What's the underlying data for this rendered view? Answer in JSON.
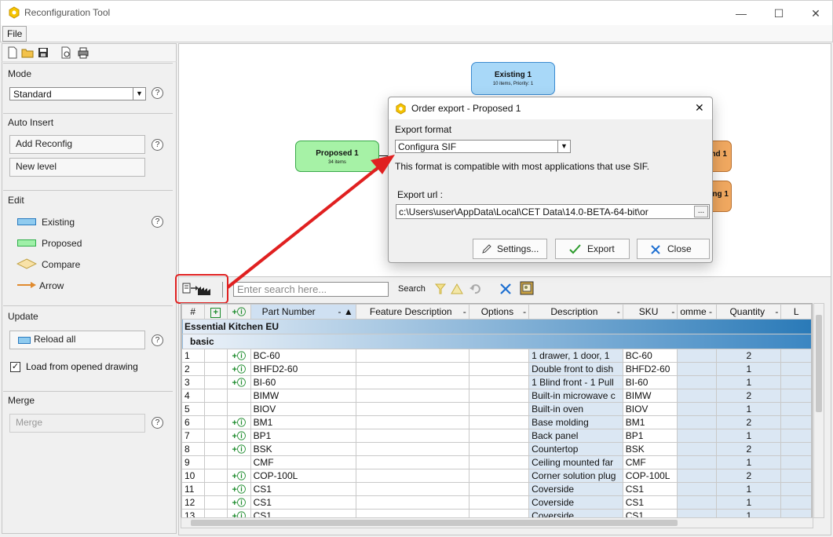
{
  "window": {
    "title": "Reconfiguration Tool",
    "controls": {
      "minimize": "—",
      "maximize": "☐",
      "close": "✕"
    }
  },
  "menu": {
    "file": "File"
  },
  "left_panel": {
    "mode": {
      "title": "Mode",
      "value": "Standard"
    },
    "auto_insert": {
      "title": "Auto Insert",
      "add_reconfig": "Add Reconfig",
      "new_level": "New level"
    },
    "edit": {
      "title": "Edit",
      "legend": [
        {
          "label": "Existing",
          "color": "#8fcbef"
        },
        {
          "label": "Proposed",
          "color": "#9ff0a8"
        },
        {
          "label": "Compare",
          "color": "#f8e2a8"
        },
        {
          "label": "Arrow",
          "color": "#e08a2e"
        }
      ]
    },
    "update": {
      "title": "Update",
      "reload_all": "Reload all",
      "load_from_opened": "Load from opened drawing",
      "load_checked": true
    },
    "merge": {
      "title": "Merge",
      "merge_button": "Merge"
    },
    "help": "?"
  },
  "canvas": {
    "nodes": {
      "existing": {
        "label": "Existing 1",
        "sub": "10 items, Priority: 1",
        "color": "#a8d8f8"
      },
      "proposed": {
        "label": "Proposed 1",
        "sub": "34 items",
        "color": "#a6f2a6"
      },
      "orange1": {
        "label": "nd 1",
        "color": "#f0a860"
      },
      "orange2": {
        "label": "ing 1",
        "color": "#f0a860"
      }
    }
  },
  "dialog": {
    "title": "Order export - Proposed 1",
    "format_label": "Export format",
    "format_value": "Configura SIF",
    "format_note": "This format is compatible with most applications that use SIF.",
    "url_label": "Export url :",
    "url_value": "c:\\Users\\user\\AppData\\Local\\CET Data\\14.0-BETA-64-bit\\or",
    "browse": "...",
    "buttons": {
      "settings": "Settings...",
      "export": "Export",
      "close": "Close"
    },
    "close_x": "✕"
  },
  "grid_toolbar": {
    "search_placeholder": "Enter search here...",
    "search_label": "Search"
  },
  "grid": {
    "columns": [
      "#",
      "+",
      "i",
      "Part Number",
      "Feature Description",
      "Options",
      "Description",
      "SKU",
      "omme",
      "Quantity",
      "L"
    ],
    "group": "Essential Kitchen EU",
    "subgroup": "basic",
    "rows": [
      {
        "n": "1",
        "icon": true,
        "part": "BC-60",
        "desc": "1 drawer, 1 door, 1",
        "sku": "BC-60",
        "qty": "2"
      },
      {
        "n": "2",
        "icon": true,
        "part": "BHFD2-60",
        "desc": "Double front to dish",
        "sku": "BHFD2-60",
        "qty": "1"
      },
      {
        "n": "3",
        "icon": true,
        "part": "BI-60",
        "desc": "1 Blind front - 1 Pull",
        "sku": "BI-60",
        "qty": "1"
      },
      {
        "n": "4",
        "icon": false,
        "part": "BIMW",
        "desc": "Built-in microwave c",
        "sku": "BIMW",
        "qty": "2"
      },
      {
        "n": "5",
        "icon": false,
        "part": "BIOV",
        "desc": "Built-in oven",
        "sku": "BIOV",
        "qty": "1"
      },
      {
        "n": "6",
        "icon": true,
        "part": "BM1",
        "desc": "Base molding",
        "sku": "BM1",
        "qty": "2"
      },
      {
        "n": "7",
        "icon": true,
        "part": "BP1",
        "desc": "Back panel",
        "sku": "BP1",
        "qty": "1"
      },
      {
        "n": "8",
        "icon": true,
        "part": "BSK",
        "desc": "Countertop",
        "sku": "BSK",
        "qty": "2"
      },
      {
        "n": "9",
        "icon": false,
        "part": "CMF",
        "desc": "Ceiling mounted far",
        "sku": "CMF",
        "qty": "1"
      },
      {
        "n": "10",
        "icon": true,
        "part": "COP-100L",
        "desc": "Corner solution plug",
        "sku": "COP-100L",
        "qty": "2"
      },
      {
        "n": "11",
        "icon": true,
        "part": "CS1",
        "desc": "Coverside",
        "sku": "CS1",
        "qty": "1"
      },
      {
        "n": "12",
        "icon": true,
        "part": "CS1",
        "desc": "Coverside",
        "sku": "CS1",
        "qty": "1"
      },
      {
        "n": "13",
        "icon": true,
        "part": "CS1",
        "desc": "Coverside",
        "sku": "CS1",
        "qty": "1"
      }
    ]
  },
  "annotation": {
    "highlight_color": "#e02020",
    "arrow_color": "#e02020"
  }
}
